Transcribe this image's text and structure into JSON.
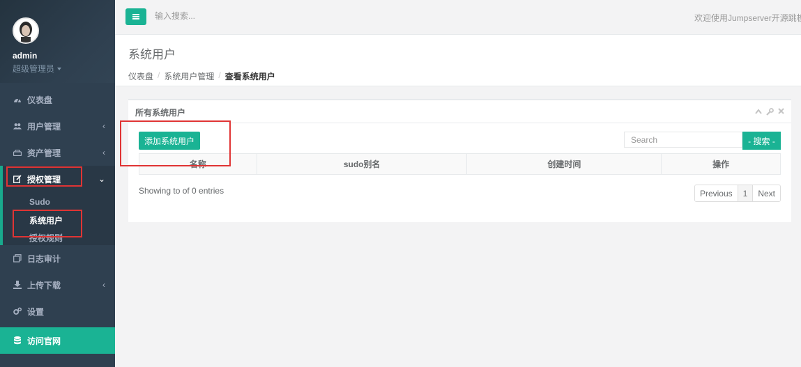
{
  "sidebar": {
    "user_name": "admin",
    "user_role": "超级管理员",
    "items": [
      {
        "label": "仪表盘"
      },
      {
        "label": "用户管理"
      },
      {
        "label": "资产管理"
      },
      {
        "label": "授权管理"
      },
      {
        "label": "日志审计"
      },
      {
        "label": "上传下载"
      },
      {
        "label": "设置"
      },
      {
        "label": "访问官网"
      }
    ],
    "sub_items": [
      {
        "label": "Sudo"
      },
      {
        "label": "系统用户"
      },
      {
        "label": "授权规则"
      }
    ]
  },
  "topbar": {
    "search_placeholder": "输入搜索...",
    "welcome": "欢迎使用Jumpserver开源跳板机"
  },
  "page": {
    "title": "系统用户",
    "breadcrumb": [
      "仪表盘",
      "系统用户管理",
      "查看系统用户"
    ]
  },
  "panel": {
    "title": "所有系统用户",
    "add_button": "添加系统用户",
    "search_placeholder": "Search",
    "search_button": "- 搜索 -",
    "columns": [
      "名称",
      "sudo别名",
      "创建时间",
      "操作"
    ],
    "entries_info": "Showing to of 0 entries",
    "pagination": {
      "previous": "Previous",
      "page": "1",
      "next": "Next"
    }
  },
  "colors": {
    "sidebar_bg": "#2f4050",
    "accent": "#1ab394",
    "annotation": "#e03434"
  }
}
